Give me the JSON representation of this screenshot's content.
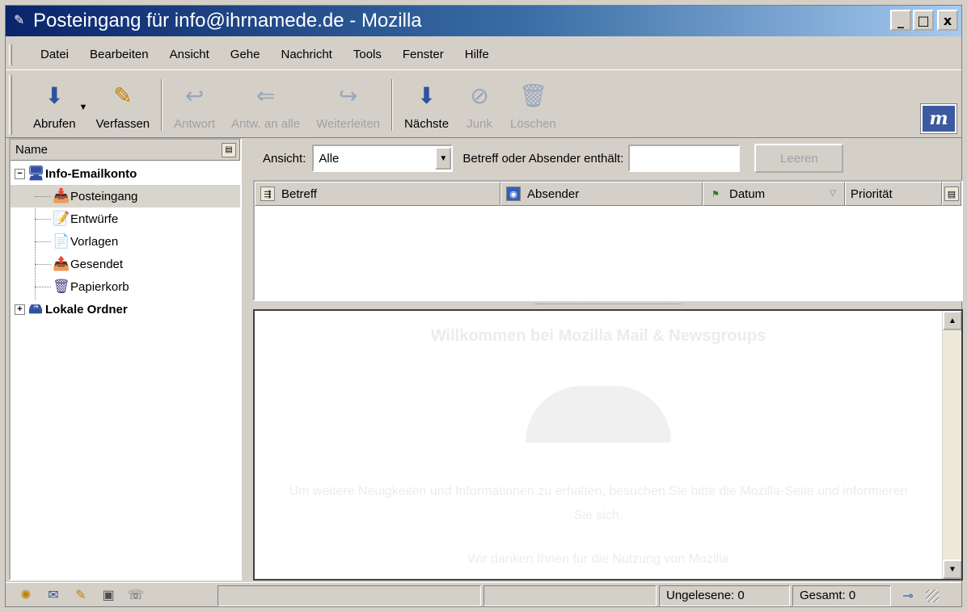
{
  "window": {
    "title": "Posteingang für info@ihrnamede.de - Mozilla",
    "minimize": "_",
    "maximize": "□",
    "close": "x"
  },
  "menu": [
    "Datei",
    "Bearbeiten",
    "Ansicht",
    "Gehe",
    "Nachricht",
    "Tools",
    "Fenster",
    "Hilfe"
  ],
  "toolbar": {
    "get": "Abrufen",
    "compose": "Verfassen",
    "reply": "Antwort",
    "reply_all": "Antw. an alle",
    "forward": "Weiterleiten",
    "next": "Nächste",
    "junk": "Junk",
    "delete": "Löschen",
    "logo": "m"
  },
  "folders": {
    "header": "Name",
    "account": "Info-Emailkonto",
    "items": [
      "Posteingang",
      "Entwürfe",
      "Vorlagen",
      "Gesendet",
      "Papierkorb"
    ],
    "local": "Lokale Ordner"
  },
  "search": {
    "view_label": "Ansicht:",
    "view_value": "Alle",
    "subject_label": "Betreff oder Absender enthält:",
    "value": "",
    "clear": "Leeren"
  },
  "columns": {
    "subject": "Betreff",
    "sender": "Absender",
    "date": "Datum",
    "priority": "Priorität"
  },
  "preview": {
    "title": "Willkommen bei Mozilla Mail & Newsgroups",
    "text": "Um weitere Neuigkeiten und Informationen zu erhalten, besuchen Sie bitte die Mozilla-Seite und informieren Sie sich.",
    "text2": "Wir danken Ihnen für die Nutzung von Mozilla"
  },
  "status": {
    "unread": "Ungelesene: 0",
    "total": "Gesamt: 0"
  }
}
